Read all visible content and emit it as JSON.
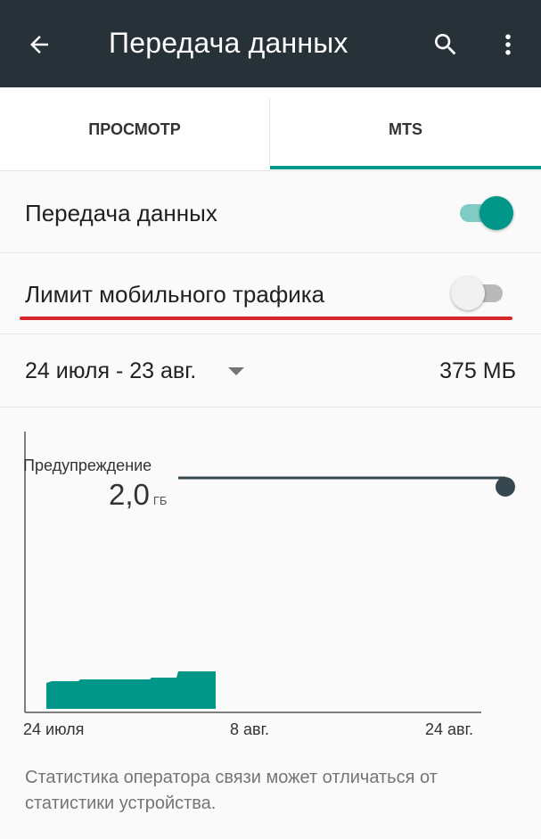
{
  "appbar": {
    "title": "Передача данных",
    "back_icon": "arrow-back-icon",
    "search_icon": "search-icon",
    "more_icon": "more-vert-icon",
    "color": "#263238"
  },
  "tabs": [
    {
      "label": "ПРОСМОТР",
      "selected": false
    },
    {
      "label": "MTS",
      "selected": true
    }
  ],
  "accent_color": "#009688",
  "settings": {
    "data_transfer": {
      "label": "Передача данных",
      "enabled": true
    },
    "mobile_limit": {
      "label": "Лимит мобильного трафика",
      "enabled": false,
      "highlight_color": "#d62828"
    }
  },
  "cycle": {
    "range": "24 июля - 23 авг.",
    "total": "375 МБ"
  },
  "chart_data": {
    "type": "area",
    "warning": {
      "label": "Предупреждение",
      "value": "2,0",
      "unit": "ГБ"
    },
    "x_ticks": [
      "24 июля",
      "8 авг.",
      "24 авг."
    ],
    "usage_fraction_of_cycle": 0.42
  },
  "footnote": "Статистика оператора связи может отличаться от статистики устройства."
}
